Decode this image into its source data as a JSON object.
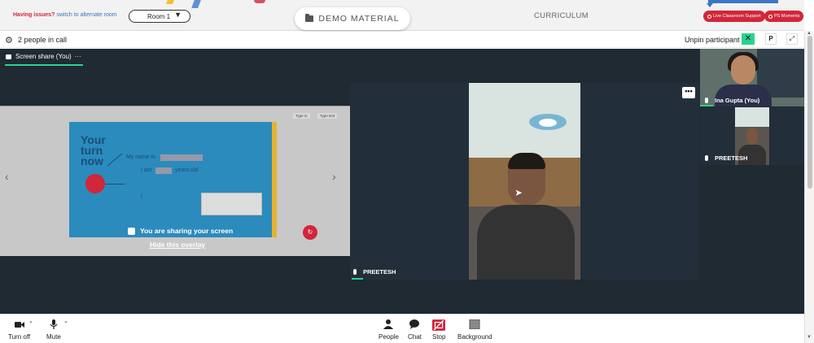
{
  "topbar": {
    "issues_label": "Having issues?",
    "switch_label": "switch to alternate room",
    "room_label": "Room 1",
    "demo_label": "DEMO MATERIAL",
    "curriculum_label": "CURRICULUM",
    "support_label": "Live Classroom Support",
    "moments_label": "PS Moments"
  },
  "callbar": {
    "people_count": "2 people in call",
    "unpin_label": "Unpin participant",
    "close_label": "✕",
    "p_label": "P",
    "expand_label": "⤢"
  },
  "share": {
    "tab_label": "Screen share (You)",
    "tab_more": "···",
    "sharing_msg": "You are sharing your screen",
    "hide_link": "Hide this overlay",
    "slide_title": "Your turn now",
    "line1": "My name is",
    "line2": "I am",
    "line2b": "years old",
    "line3": "I",
    "mini_btn1": "Type in",
    "mini_btn2": "Type text",
    "nav_left": "‹",
    "nav_right": "›"
  },
  "main_video": {
    "name": "PREETESH",
    "more": "•••"
  },
  "side_tiles": [
    {
      "name": "Ina Gupta (You)"
    },
    {
      "name": "PREETESH"
    }
  ],
  "toolbar": {
    "camera_label": "Turn off",
    "mic_label": "Mute",
    "people_label": "People",
    "chat_label": "Chat",
    "stop_label": "Stop",
    "background_label": "Background"
  },
  "colors": {
    "accent_red": "#d2263a",
    "accent_green": "#2bd18d",
    "accent_blue": "#3a77c5",
    "stage_bg": "#1f2a33"
  }
}
